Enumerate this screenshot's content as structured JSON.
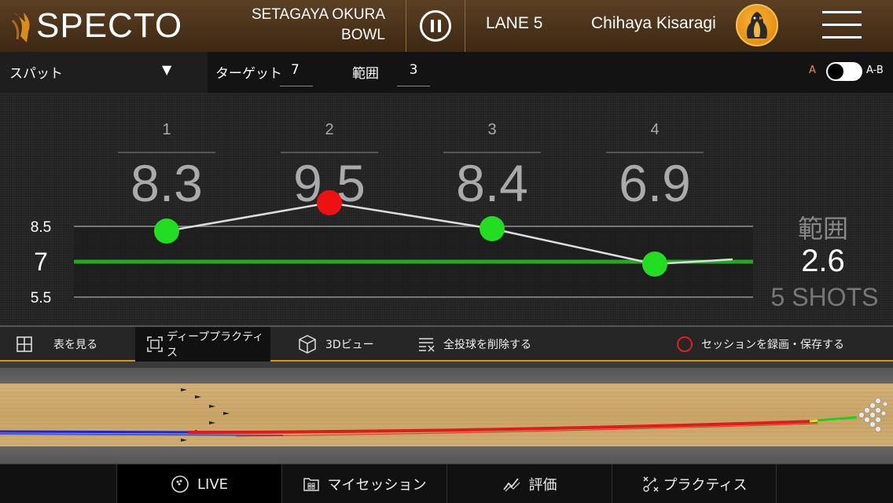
{
  "header": {
    "logo_text": "SPECTO",
    "venue_line1": "SETAGAYA OKURA",
    "venue_line2": "BOWL",
    "lane": "LANE 5",
    "user_name": "Chihaya Kisaragi",
    "icons": [
      "pause-icon",
      "avatar",
      "hamburger-menu-icon"
    ]
  },
  "filters": {
    "spot_label": "スパット",
    "spot_arrow": "▼",
    "target_label": "ターゲット",
    "target_value": "7",
    "range_label": "範囲",
    "range_value": "3",
    "mode_a": "A",
    "mode_ab": "A-B",
    "mode_toggle_on": false
  },
  "stats": {
    "range_title": "範囲",
    "range_value": "2.6",
    "shots": "5 SHOTS"
  },
  "chart_data": {
    "type": "line",
    "title": "",
    "xlabel": "",
    "ylabel": "",
    "x": [
      1,
      2,
      3,
      4,
      5
    ],
    "shot_labels": [
      "1",
      "2",
      "3",
      "4"
    ],
    "shot_values_display": [
      "8.3",
      "9.5",
      "8.4",
      "6.9"
    ],
    "values": [
      8.3,
      9.5,
      8.4,
      6.9,
      7.1
    ],
    "point_status": [
      "in",
      "out",
      "in",
      "in",
      "none"
    ],
    "target": 7,
    "band": [
      5.5,
      8.5
    ],
    "ylim": [
      5.5,
      8.5
    ],
    "ytick_labels": [
      "8.5",
      "7",
      "5.5"
    ],
    "colors": {
      "in": "#22dd22",
      "out": "#ee1111",
      "target_line": "#1faa1f",
      "trace": "#dddddd"
    }
  },
  "toolbar": {
    "table_label": "表を見る",
    "deep_label": "ディーププラクティス",
    "view3d_label": "3Dビュー",
    "delete_label": "全投球を削除する",
    "record_label": "セッションを録画・保存する",
    "icons": [
      "grid-icon",
      "frame-icon",
      "cube-icon",
      "clear-list-icon",
      "record-icon"
    ]
  },
  "nav": {
    "live": "LIVE",
    "sessions": "マイセッション",
    "evaluation": "評価",
    "practice": "プラクティス",
    "icons": [
      "bowling-ball-icon",
      "sessions-icon",
      "trend-icon",
      "practice-icon"
    ]
  },
  "colors": {
    "accent": "#d7941f",
    "header_bg": "#4a3219",
    "lane_wood": "#c9a66b"
  }
}
